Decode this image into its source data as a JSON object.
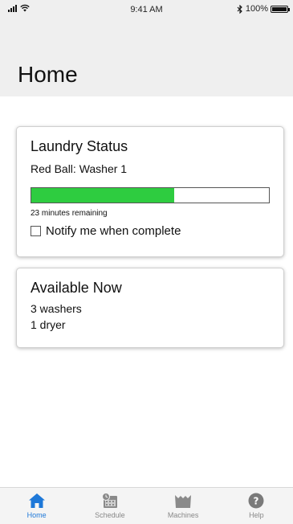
{
  "status_bar": {
    "time": "9:41 AM",
    "battery": "100%"
  },
  "header": {
    "title": "Home"
  },
  "laundry_status": {
    "title": "Laundry Status",
    "machine": "Red Ball: Washer 1",
    "progress_fraction": 0.6,
    "remaining": "23 minutes remaining",
    "notify_label": "Notify me when complete",
    "notify_checked": false,
    "progress_color": "#2ecc40"
  },
  "available_now": {
    "title": "Available Now",
    "washers": "3 washers",
    "dryers": "1 dryer"
  },
  "tabs": [
    {
      "label": "Home",
      "icon": "home-icon",
      "active": true
    },
    {
      "label": "Schedule",
      "icon": "calendar-clock-icon",
      "active": false
    },
    {
      "label": "Machines",
      "icon": "washer-tub-icon",
      "active": false
    },
    {
      "label": "Help",
      "icon": "help-icon",
      "active": false
    }
  ],
  "colors": {
    "accent": "#1e78d8",
    "inactive_icon": "#8a8a8a"
  }
}
